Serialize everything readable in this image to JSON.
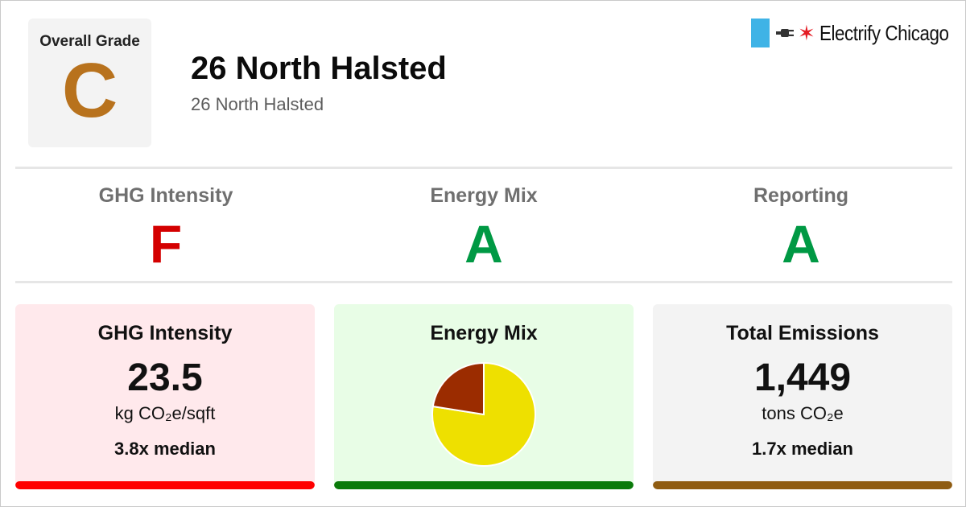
{
  "colors": {
    "grade_c": "#b8721d",
    "grade_f": "#d40000",
    "grade_a": "#009944",
    "brand_blue": "#3fb3e6",
    "brand_red": "#e41b23",
    "card_red_bg": "#ffe9ec",
    "card_green_bg": "#e8fde6",
    "card_gray_bg": "#f3f3f3",
    "bar_red": "#ff0000",
    "bar_green": "#0a7a0a",
    "bar_brown": "#8f5c12",
    "pie_yellow": "#eee000",
    "pie_brown": "#9b2c00"
  },
  "header": {
    "overall_label": "Overall Grade",
    "overall_grade": "C",
    "building_name": "26 North Halsted",
    "building_address": "26 North Halsted",
    "brand_name": "Electrify Chicago",
    "brand_icons": [
      "flag-bar-icon",
      "plug-icon",
      "star-icon"
    ]
  },
  "grades": [
    {
      "label": "GHG Intensity",
      "grade": "F"
    },
    {
      "label": "Energy Mix",
      "grade": "A"
    },
    {
      "label": "Reporting",
      "grade": "A"
    }
  ],
  "cards": {
    "ghg": {
      "title": "GHG Intensity",
      "value": "23.5",
      "unit": "kg CO₂e/sqft",
      "note": "3.8x median"
    },
    "energy": {
      "title": "Energy Mix",
      "chart_data": {
        "type": "pie",
        "slices": [
          {
            "value": 0.775,
            "color": "#eee000"
          },
          {
            "value": 0.225,
            "color": "#9b2c00"
          }
        ]
      }
    },
    "emissions": {
      "title": "Total Emissions",
      "value": "1,449",
      "unit": "tons CO₂e",
      "note": "1.7x median"
    }
  }
}
